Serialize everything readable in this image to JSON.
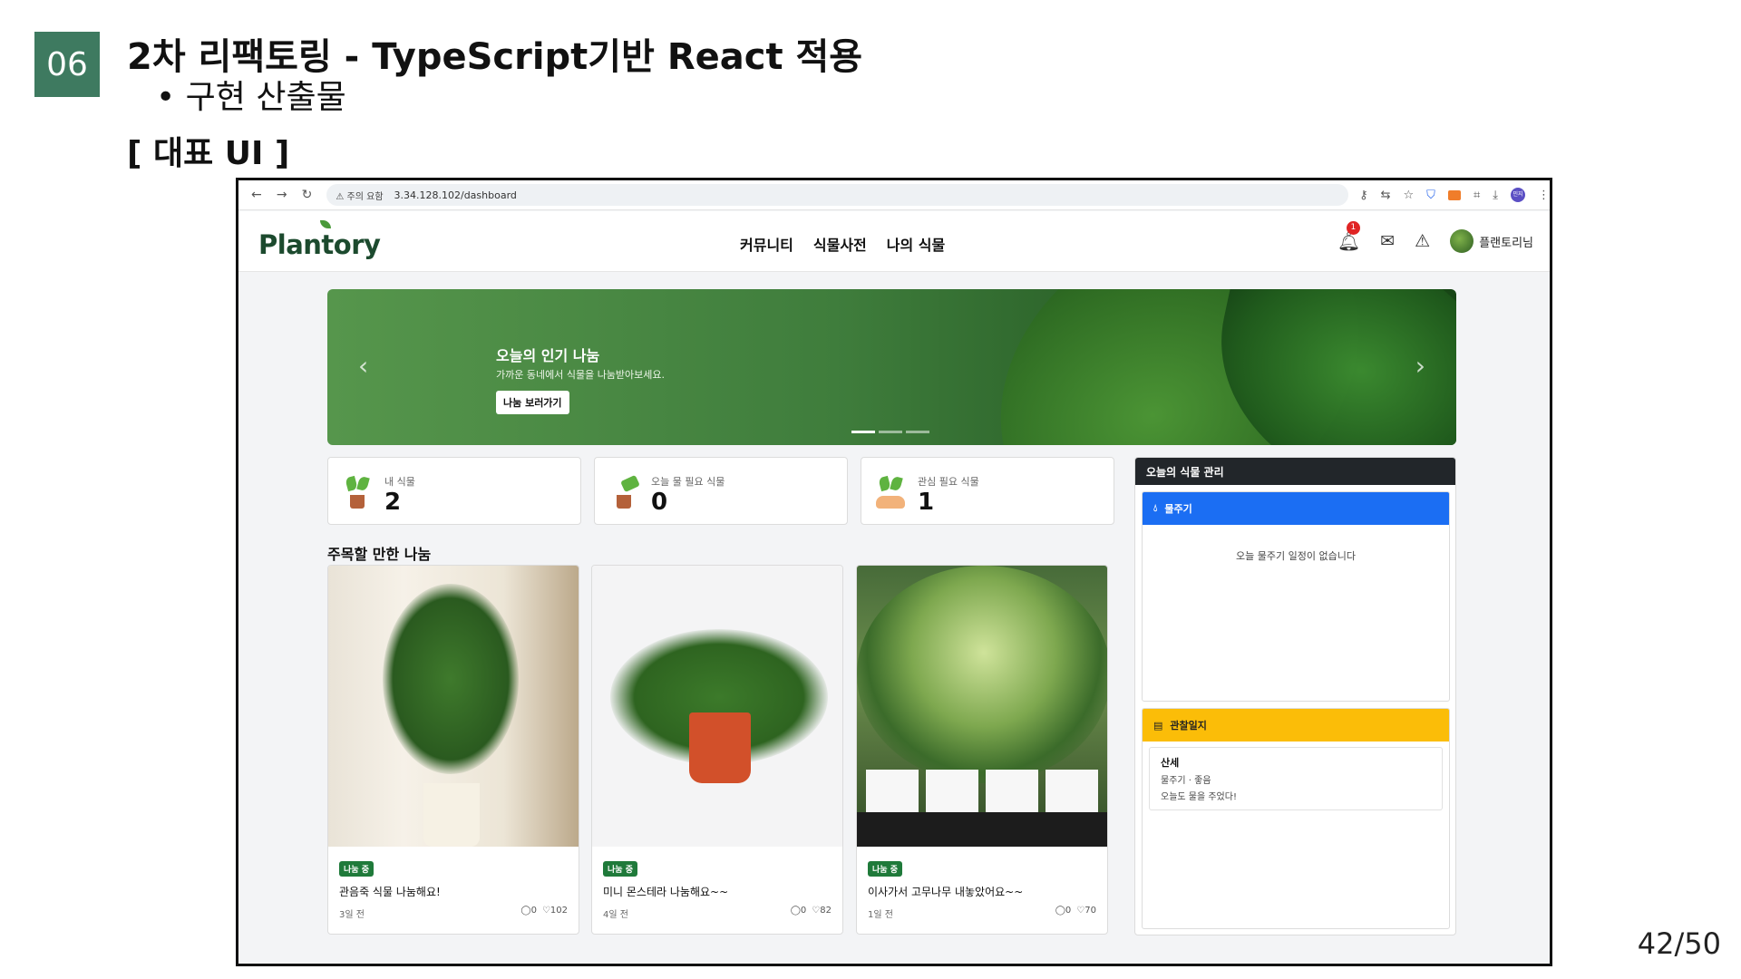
{
  "slide": {
    "section_number": "06",
    "title": "2차 리팩토링 - TypeScript기반 React 적용",
    "subtitle": "• 구현 산출물",
    "label": "[  대표 UI ]",
    "page": "42/50"
  },
  "browser": {
    "security_warning": "⚠ 주의 요함",
    "url": "3.34.128.102/dashboard",
    "profile_initials": "민지"
  },
  "app": {
    "logo": "Plantory",
    "nav": [
      "커뮤니티",
      "식물사전",
      "나의 식물"
    ],
    "notification_count": "1",
    "user_name": "플랜토리님"
  },
  "hero": {
    "title": "오늘의 인기 나눔",
    "subtitle": "가까운 동네에서 식물을 나눔받아보세요.",
    "button": "나눔 보러가기",
    "prev": "‹",
    "next": "›"
  },
  "stats": [
    {
      "label": "내 식물",
      "value": "2",
      "icon": "potted-sprout-icon"
    },
    {
      "label": "오늘 물 필요 식물",
      "value": "0",
      "icon": "watering-can-icon"
    },
    {
      "label": "관심 필요 식물",
      "value": "1",
      "icon": "hands-sprout-icon"
    }
  ],
  "featured": {
    "title": "주목할 만한 나눔",
    "cards": [
      {
        "tag": "나눔 중",
        "title": "관음죽 식물 나눔해요!",
        "time": "3일 전",
        "comments": "◯0",
        "likes": "♡102"
      },
      {
        "tag": "나눔 중",
        "title": "미니 몬스테라 나눔해요~~",
        "time": "4일 전",
        "comments": "◯0",
        "likes": "♡82"
      },
      {
        "tag": "나눔 중",
        "title": "이사가서 고무나무 내놓았어요~~",
        "time": "1일 전",
        "comments": "◯0",
        "likes": "♡70"
      }
    ]
  },
  "panel": {
    "title": "오늘의 식물 관리",
    "watering": {
      "title": "물주기",
      "empty": "오늘 물주기 일정이 없습니다"
    },
    "journal": {
      "title": "관찰일지",
      "entry": {
        "name": "산세",
        "meta": "물주기 · 좋음",
        "note": "오늘도 물을 주었다!"
      }
    }
  },
  "colors": {
    "section_badge": "#3e7a60",
    "watering_header": "#1b6ef3",
    "journal_header": "#fbbd08",
    "share_tag": "#1f7a3a",
    "panel_header": "#22262a"
  }
}
